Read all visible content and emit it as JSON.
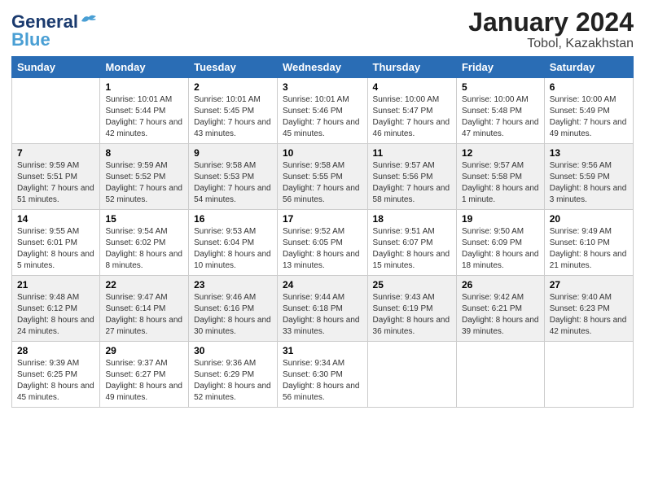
{
  "header": {
    "logo_general": "General",
    "logo_blue": "Blue",
    "title": "January 2024",
    "subtitle": "Tobol, Kazakhstan"
  },
  "days_of_week": [
    "Sunday",
    "Monday",
    "Tuesday",
    "Wednesday",
    "Thursday",
    "Friday",
    "Saturday"
  ],
  "weeks": [
    [
      {
        "day": "",
        "sunrise": "",
        "sunset": "",
        "daylight": ""
      },
      {
        "day": "1",
        "sunrise": "Sunrise: 10:01 AM",
        "sunset": "Sunset: 5:44 PM",
        "daylight": "Daylight: 7 hours and 42 minutes."
      },
      {
        "day": "2",
        "sunrise": "Sunrise: 10:01 AM",
        "sunset": "Sunset: 5:45 PM",
        "daylight": "Daylight: 7 hours and 43 minutes."
      },
      {
        "day": "3",
        "sunrise": "Sunrise: 10:01 AM",
        "sunset": "Sunset: 5:46 PM",
        "daylight": "Daylight: 7 hours and 45 minutes."
      },
      {
        "day": "4",
        "sunrise": "Sunrise: 10:00 AM",
        "sunset": "Sunset: 5:47 PM",
        "daylight": "Daylight: 7 hours and 46 minutes."
      },
      {
        "day": "5",
        "sunrise": "Sunrise: 10:00 AM",
        "sunset": "Sunset: 5:48 PM",
        "daylight": "Daylight: 7 hours and 47 minutes."
      },
      {
        "day": "6",
        "sunrise": "Sunrise: 10:00 AM",
        "sunset": "Sunset: 5:49 PM",
        "daylight": "Daylight: 7 hours and 49 minutes."
      }
    ],
    [
      {
        "day": "7",
        "sunrise": "Sunrise: 9:59 AM",
        "sunset": "Sunset: 5:51 PM",
        "daylight": "Daylight: 7 hours and 51 minutes."
      },
      {
        "day": "8",
        "sunrise": "Sunrise: 9:59 AM",
        "sunset": "Sunset: 5:52 PM",
        "daylight": "Daylight: 7 hours and 52 minutes."
      },
      {
        "day": "9",
        "sunrise": "Sunrise: 9:58 AM",
        "sunset": "Sunset: 5:53 PM",
        "daylight": "Daylight: 7 hours and 54 minutes."
      },
      {
        "day": "10",
        "sunrise": "Sunrise: 9:58 AM",
        "sunset": "Sunset: 5:55 PM",
        "daylight": "Daylight: 7 hours and 56 minutes."
      },
      {
        "day": "11",
        "sunrise": "Sunrise: 9:57 AM",
        "sunset": "Sunset: 5:56 PM",
        "daylight": "Daylight: 7 hours and 58 minutes."
      },
      {
        "day": "12",
        "sunrise": "Sunrise: 9:57 AM",
        "sunset": "Sunset: 5:58 PM",
        "daylight": "Daylight: 8 hours and 1 minute."
      },
      {
        "day": "13",
        "sunrise": "Sunrise: 9:56 AM",
        "sunset": "Sunset: 5:59 PM",
        "daylight": "Daylight: 8 hours and 3 minutes."
      }
    ],
    [
      {
        "day": "14",
        "sunrise": "Sunrise: 9:55 AM",
        "sunset": "Sunset: 6:01 PM",
        "daylight": "Daylight: 8 hours and 5 minutes."
      },
      {
        "day": "15",
        "sunrise": "Sunrise: 9:54 AM",
        "sunset": "Sunset: 6:02 PM",
        "daylight": "Daylight: 8 hours and 8 minutes."
      },
      {
        "day": "16",
        "sunrise": "Sunrise: 9:53 AM",
        "sunset": "Sunset: 6:04 PM",
        "daylight": "Daylight: 8 hours and 10 minutes."
      },
      {
        "day": "17",
        "sunrise": "Sunrise: 9:52 AM",
        "sunset": "Sunset: 6:05 PM",
        "daylight": "Daylight: 8 hours and 13 minutes."
      },
      {
        "day": "18",
        "sunrise": "Sunrise: 9:51 AM",
        "sunset": "Sunset: 6:07 PM",
        "daylight": "Daylight: 8 hours and 15 minutes."
      },
      {
        "day": "19",
        "sunrise": "Sunrise: 9:50 AM",
        "sunset": "Sunset: 6:09 PM",
        "daylight": "Daylight: 8 hours and 18 minutes."
      },
      {
        "day": "20",
        "sunrise": "Sunrise: 9:49 AM",
        "sunset": "Sunset: 6:10 PM",
        "daylight": "Daylight: 8 hours and 21 minutes."
      }
    ],
    [
      {
        "day": "21",
        "sunrise": "Sunrise: 9:48 AM",
        "sunset": "Sunset: 6:12 PM",
        "daylight": "Daylight: 8 hours and 24 minutes."
      },
      {
        "day": "22",
        "sunrise": "Sunrise: 9:47 AM",
        "sunset": "Sunset: 6:14 PM",
        "daylight": "Daylight: 8 hours and 27 minutes."
      },
      {
        "day": "23",
        "sunrise": "Sunrise: 9:46 AM",
        "sunset": "Sunset: 6:16 PM",
        "daylight": "Daylight: 8 hours and 30 minutes."
      },
      {
        "day": "24",
        "sunrise": "Sunrise: 9:44 AM",
        "sunset": "Sunset: 6:18 PM",
        "daylight": "Daylight: 8 hours and 33 minutes."
      },
      {
        "day": "25",
        "sunrise": "Sunrise: 9:43 AM",
        "sunset": "Sunset: 6:19 PM",
        "daylight": "Daylight: 8 hours and 36 minutes."
      },
      {
        "day": "26",
        "sunrise": "Sunrise: 9:42 AM",
        "sunset": "Sunset: 6:21 PM",
        "daylight": "Daylight: 8 hours and 39 minutes."
      },
      {
        "day": "27",
        "sunrise": "Sunrise: 9:40 AM",
        "sunset": "Sunset: 6:23 PM",
        "daylight": "Daylight: 8 hours and 42 minutes."
      }
    ],
    [
      {
        "day": "28",
        "sunrise": "Sunrise: 9:39 AM",
        "sunset": "Sunset: 6:25 PM",
        "daylight": "Daylight: 8 hours and 45 minutes."
      },
      {
        "day": "29",
        "sunrise": "Sunrise: 9:37 AM",
        "sunset": "Sunset: 6:27 PM",
        "daylight": "Daylight: 8 hours and 49 minutes."
      },
      {
        "day": "30",
        "sunrise": "Sunrise: 9:36 AM",
        "sunset": "Sunset: 6:29 PM",
        "daylight": "Daylight: 8 hours and 52 minutes."
      },
      {
        "day": "31",
        "sunrise": "Sunrise: 9:34 AM",
        "sunset": "Sunset: 6:30 PM",
        "daylight": "Daylight: 8 hours and 56 minutes."
      },
      {
        "day": "",
        "sunrise": "",
        "sunset": "",
        "daylight": ""
      },
      {
        "day": "",
        "sunrise": "",
        "sunset": "",
        "daylight": ""
      },
      {
        "day": "",
        "sunrise": "",
        "sunset": "",
        "daylight": ""
      }
    ]
  ]
}
